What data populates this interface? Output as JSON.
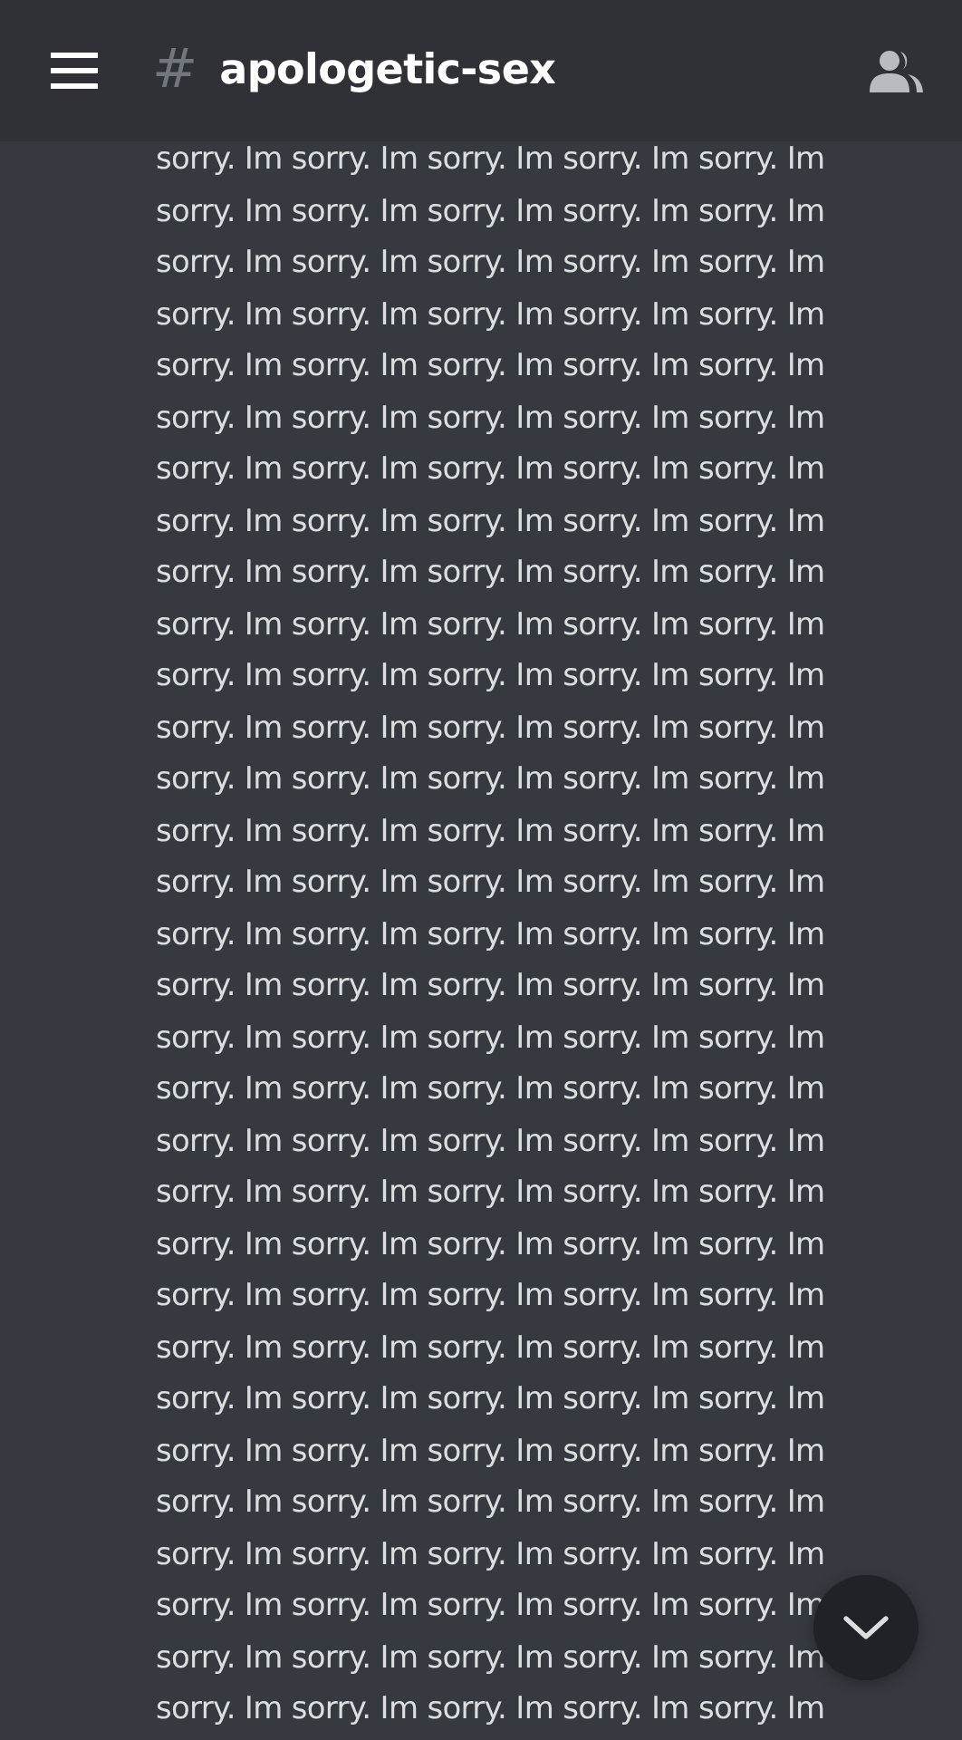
{
  "header": {
    "channel_prefix": "#",
    "channel_name": "apologetic-sex"
  },
  "message": {
    "text": "sorry. Im sorry. Im sorry. Im sorry. Im sorry. Im\nsorry. Im sorry. Im sorry. Im sorry. Im sorry. Im\nsorry. Im sorry. Im sorry. Im sorry. Im sorry. Im\nsorry. Im sorry. Im sorry. Im sorry. Im sorry. Im\nsorry. Im sorry. Im sorry. Im sorry. Im sorry. Im\nsorry. Im sorry. Im sorry. Im sorry. Im sorry. Im\nsorry. Im sorry. Im sorry. Im sorry. Im sorry. Im\nsorry. Im sorry. Im sorry. Im sorry. Im sorry. Im\nsorry. Im sorry. Im sorry. Im sorry. Im sorry. Im\nsorry. Im sorry. Im sorry. Im sorry. Im sorry. Im\nsorry. Im sorry. Im sorry. Im sorry. Im sorry. Im\nsorry. Im sorry. Im sorry. Im sorry. Im sorry. Im\nsorry. Im sorry. Im sorry. Im sorry. Im sorry. Im\nsorry. Im sorry. Im sorry. Im sorry. Im sorry. Im\nsorry. Im sorry. Im sorry. Im sorry. Im sorry. Im\nsorry. Im sorry. Im sorry. Im sorry. Im sorry. Im\nsorry. Im sorry. Im sorry. Im sorry. Im sorry. Im\nsorry. Im sorry. Im sorry. Im sorry. Im sorry. Im\nsorry. Im sorry. Im sorry. Im sorry. Im sorry. Im\nsorry. Im sorry. Im sorry. Im sorry. Im sorry. Im\nsorry. Im sorry. Im sorry. Im sorry. Im sorry. Im\nsorry. Im sorry. Im sorry. Im sorry. Im sorry. Im\nsorry. Im sorry. Im sorry. Im sorry. Im sorry. Im\nsorry. Im sorry. Im sorry. Im sorry. Im sorry. Im\nsorry. Im sorry. Im sorry. Im sorry. Im sorry. Im\nsorry. Im sorry. Im sorry. Im sorry. Im sorry. Im\nsorry. Im sorry. Im sorry. Im sorry. Im sorry. Im\nsorry. Im sorry. Im sorry. Im sorry. Im sorry. Im\nsorry. Im sorry. Im sorry. Im sorry. Im sorry. Im\nsorry. Im sorry. Im sorry. Im sorry. Im sorry. Im\nsorry. Im sorry. Im sorry. Im sorry. Im sorry. Im"
  }
}
